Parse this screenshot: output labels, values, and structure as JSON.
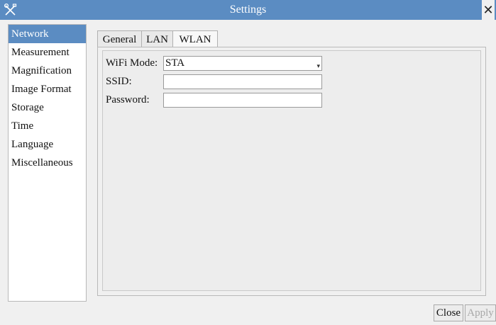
{
  "window": {
    "title": "Settings"
  },
  "sidebar": {
    "items": [
      {
        "label": "Network",
        "active": true
      },
      {
        "label": "Measurement"
      },
      {
        "label": "Magnification"
      },
      {
        "label": "Image Format"
      },
      {
        "label": "Storage"
      },
      {
        "label": "Time"
      },
      {
        "label": "Language"
      },
      {
        "label": "Miscellaneous"
      }
    ]
  },
  "tabs": [
    {
      "label": "General"
    },
    {
      "label": "LAN"
    },
    {
      "label": "WLAN",
      "active": true
    }
  ],
  "wlan": {
    "wifi_mode_label": "WiFi Mode:",
    "wifi_mode_value": "STA",
    "ssid_label": "SSID:",
    "ssid_value": "",
    "password_label": "Password:",
    "password_value": ""
  },
  "footer": {
    "close_label": "Close",
    "apply_label": "Apply"
  },
  "colors": {
    "titlebar": "#5b8cc2",
    "selection": "#5b8cc2",
    "disabled_text": "#a8a8a8"
  },
  "icons": {
    "app": "tools-icon",
    "close": "close-icon",
    "dropdown": "chevron-down-icon"
  }
}
